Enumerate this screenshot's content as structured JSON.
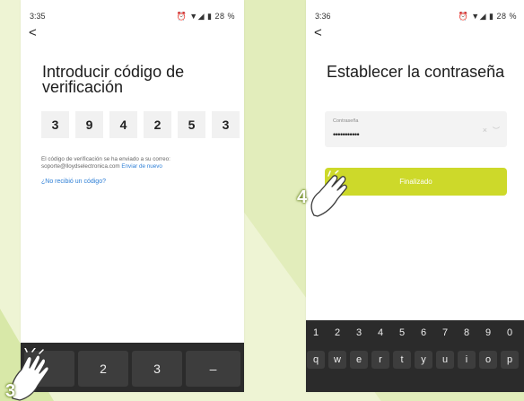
{
  "screen1": {
    "status_time": "3:35",
    "status_icons": "⏰ ▼◢ ▮ 28 %",
    "back_glyph": "<",
    "title": "Introducir código de verificación",
    "code_digits": [
      "3",
      "9",
      "4",
      "2",
      "5",
      "3"
    ],
    "sent_line1": "El código de verificación se ha enviado a su correo:",
    "sent_email": "soporte@lloydselectronica.com",
    "resend_link": "Enviar de nuevo",
    "not_received_link": "¿No recibió un código?",
    "keypad_keys": [
      "",
      "2",
      "3",
      "–"
    ]
  },
  "screen2": {
    "status_time": "3:36",
    "status_icons": "⏰ ▼◢ ▮ 28 %",
    "back_glyph": "<",
    "title": "Establecer la contraseña",
    "password_label": "Contraseña",
    "password_value": "•••••••••••",
    "clear_glyph": "×",
    "eye_glyph": "︶",
    "finish_button": "Finalizado",
    "keyboard_numbers": [
      "1",
      "2",
      "3",
      "4",
      "5",
      "6",
      "7",
      "8",
      "9",
      "0"
    ],
    "keyboard_letters": [
      "q",
      "w",
      "e",
      "r",
      "t",
      "y",
      "u",
      "i",
      "o",
      "p"
    ]
  },
  "annotations": {
    "step3": "3",
    "step4": "4"
  },
  "colors": {
    "accent": "#cdd92a",
    "link": "#2e7fd6",
    "page_background": "#eef4d4",
    "keyboard": "#2b2b2b"
  },
  "icons": [
    "back-chevron-icon",
    "alarm-icon",
    "wifi-icon",
    "signal-icon",
    "battery-icon",
    "clear-icon",
    "eye-icon",
    "pointing-hand-icon"
  ]
}
